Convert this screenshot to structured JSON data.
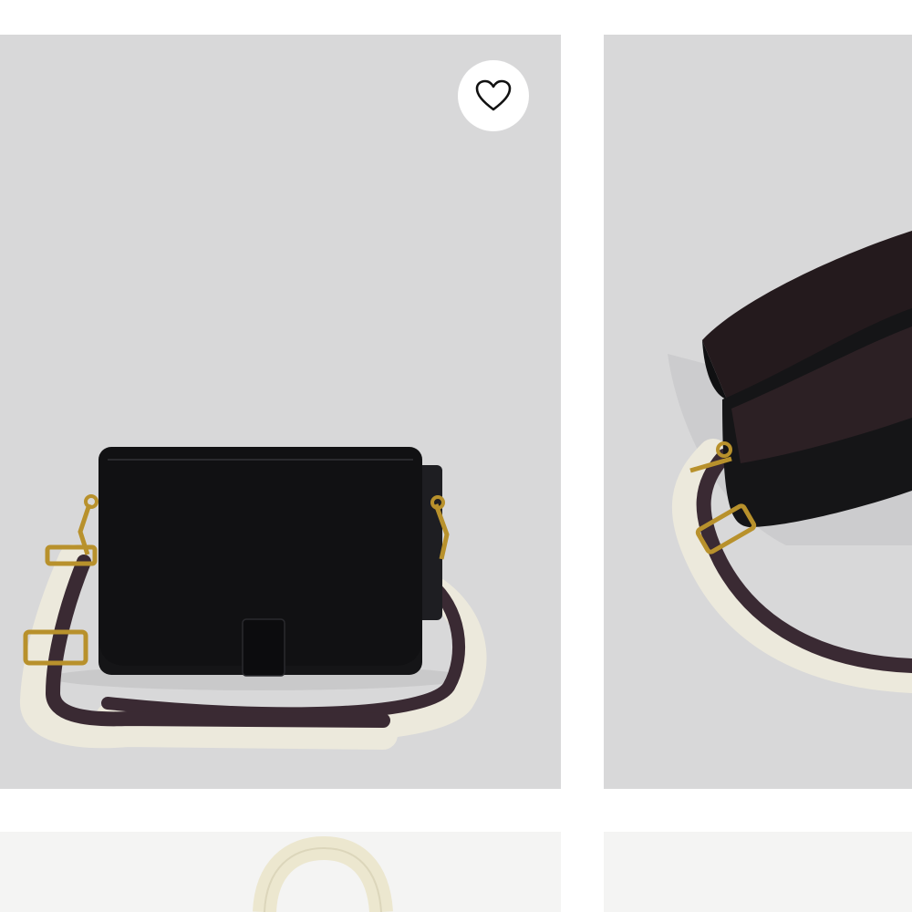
{
  "products": [
    {
      "image_icon": "black-leather-crossbody-bag-front",
      "favorite_icon": "heart-outline-icon",
      "favorited": false
    },
    {
      "image_icon": "black-leather-crossbody-bag-open-interior"
    },
    {
      "image_icon": "cream-strap-bag-partial"
    },
    {
      "image_icon": "product-image-partial"
    }
  ],
  "colors": {
    "tile_background": "#d8d8d9",
    "lower_tile_background": "#f4f4f3",
    "bag_leather": "#141416",
    "strap_stripe_dark": "#3a2a33",
    "strap_stripe_cream": "#ece9dc",
    "hardware_gold": "#b8912c",
    "page_background": "#ffffff"
  }
}
